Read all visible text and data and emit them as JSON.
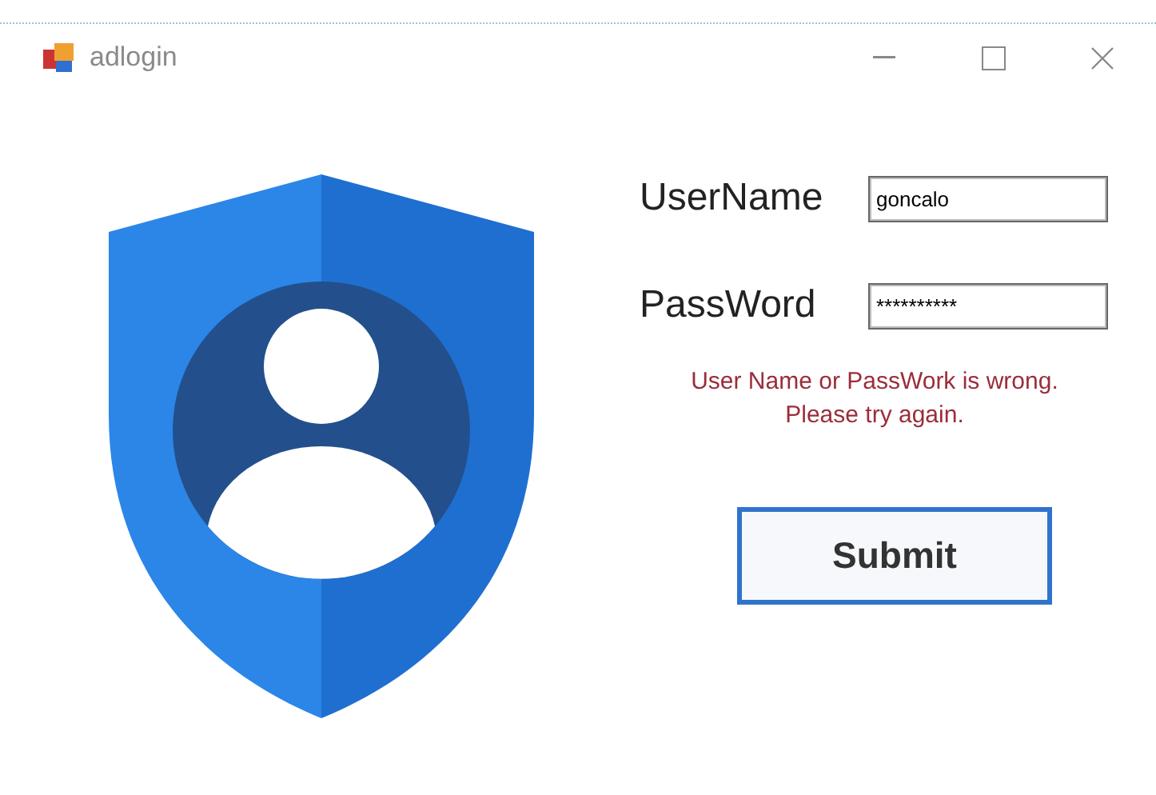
{
  "window": {
    "title": "adlogin"
  },
  "form": {
    "fields": [
      {
        "label": "UserName",
        "value": "goncalo"
      },
      {
        "label": "PassWord",
        "value": "**********"
      }
    ],
    "error": [
      "User Name or PassWork is wrong.",
      "Please try again."
    ],
    "submit": "Submit"
  }
}
